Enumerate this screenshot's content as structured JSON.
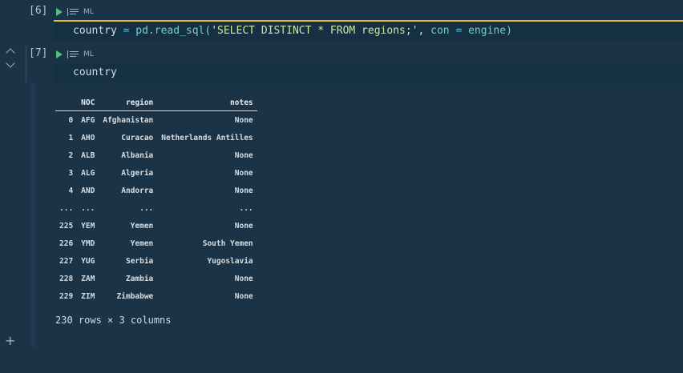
{
  "cells": [
    {
      "exec_count": "[6]",
      "ml_label": "ML",
      "code": {
        "var": "country",
        "eq": "=",
        "fn": "pd.read_sql(",
        "str": "'SELECT DISTINCT * FROM regions;'",
        "comma": ", ",
        "kw": "con",
        "eq2": "=",
        "arg": "engine)"
      }
    },
    {
      "exec_count": "[7]",
      "ml_label": "ML",
      "code": {
        "var": "country"
      }
    }
  ],
  "output": {
    "columns": [
      "",
      "NOC",
      "region",
      "notes"
    ],
    "rows": [
      [
        "0",
        "AFG",
        "Afghanistan",
        "None"
      ],
      [
        "1",
        "AHO",
        "Curacao",
        "Netherlands Antilles"
      ],
      [
        "2",
        "ALB",
        "Albania",
        "None"
      ],
      [
        "3",
        "ALG",
        "Algeria",
        "None"
      ],
      [
        "4",
        "AND",
        "Andorra",
        "None"
      ],
      [
        "...",
        "...",
        "...",
        "..."
      ],
      [
        "225",
        "YEM",
        "Yemen",
        "None"
      ],
      [
        "226",
        "YMD",
        "Yemen",
        "South Yemen"
      ],
      [
        "227",
        "YUG",
        "Serbia",
        "Yugoslavia"
      ],
      [
        "228",
        "ZAM",
        "Zambia",
        "None"
      ],
      [
        "229",
        "ZIM",
        "Zimbabwe",
        "None"
      ]
    ],
    "shape": "230 rows × 3 columns"
  },
  "icons": {
    "run": "play-icon",
    "variables": "variables-icon",
    "collapse_up": "chevron-up-icon",
    "collapse_down": "chevron-down-icon",
    "add_cell": "plus-icon"
  },
  "colors": {
    "background": "#1a3347",
    "code_bg": "#153043",
    "active_line": "#e8c021",
    "run": "#4ec27a"
  }
}
